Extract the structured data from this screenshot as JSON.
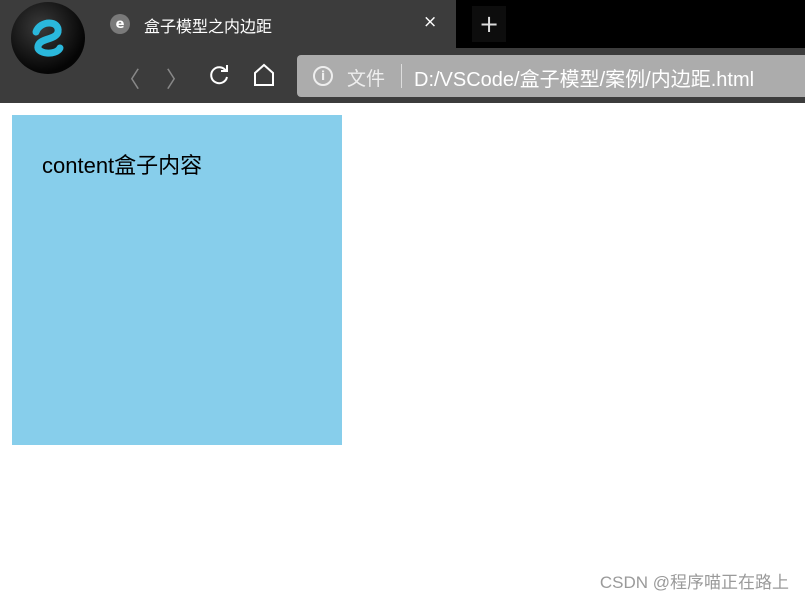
{
  "browser": {
    "tab": {
      "title": "盒子模型之内边距",
      "close_label": "×",
      "favicon": "e"
    },
    "new_tab_label": "+",
    "nav": {
      "back": "〈",
      "forward": "〉"
    },
    "address": {
      "info_icon": "i",
      "file_label": "文件",
      "url": "D:/VSCode/盒子模型/案例/内边距.html"
    }
  },
  "page": {
    "box_text": "content盒子内容",
    "box_color": "#87ceeb"
  },
  "watermark": "CSDN @程序喵正在路上"
}
